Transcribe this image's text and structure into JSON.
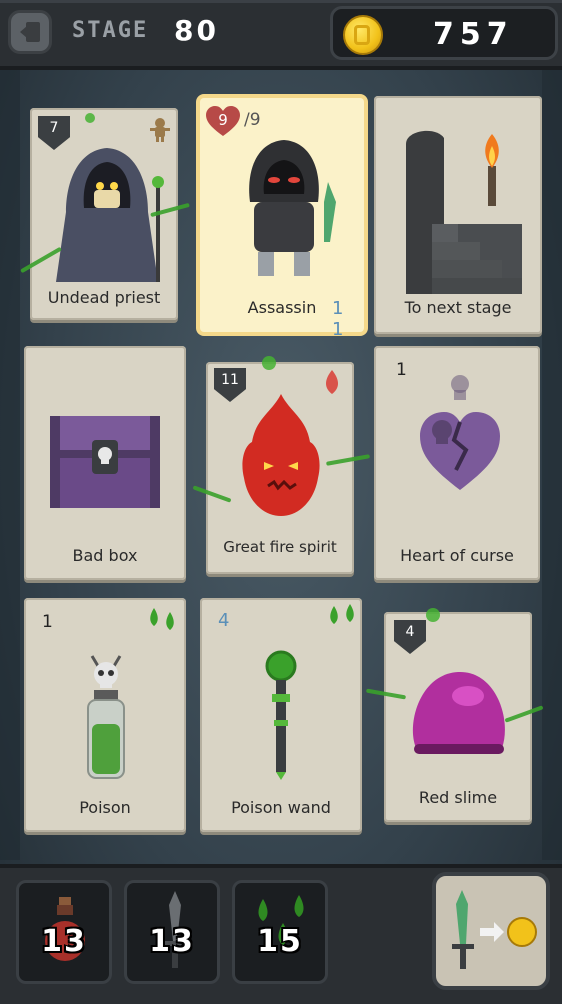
{
  "header": {
    "stage_label": "STAGE",
    "stage_number": "80",
    "coins": "757"
  },
  "cards": [
    {
      "name": "Undead priest",
      "badge": "7",
      "badge_type": "shield",
      "icon": "reaper-priest-icon"
    },
    {
      "name": "Assassin",
      "health": "9",
      "max_health": "/9",
      "secondary": "1 1",
      "icon": "assassin-icon"
    },
    {
      "name": "To next stage",
      "icon": "stairs-torch-icon"
    },
    {
      "name": "Bad box",
      "icon": "cursed-chest-icon"
    },
    {
      "name": "Great fire spirit",
      "badge": "11",
      "badge_type": "shield",
      "icon": "fire-spirit-icon"
    },
    {
      "name": "Heart of curse",
      "value": "1",
      "icon": "broken-heart-skull-icon"
    },
    {
      "name": "Poison",
      "value": "1",
      "icon": "poison-bottle-icon"
    },
    {
      "name": "Poison wand",
      "value": "4",
      "icon": "poison-wand-icon"
    },
    {
      "name": "Red slime",
      "badge": "4",
      "badge_type": "shield",
      "icon": "slime-icon"
    }
  ],
  "inventory": [
    {
      "count": "13",
      "icon": "health-potion-icon"
    },
    {
      "count": "13",
      "icon": "dagger-icon"
    },
    {
      "count": "15",
      "icon": "poison-drops-icon"
    }
  ],
  "sell": {
    "icon": "sell-weapon-for-coin-icon"
  },
  "colors": {
    "poison": "#45b132",
    "highlight": "#f4d88a",
    "fire": "#d22b22",
    "curse": "#7b5a9a"
  }
}
